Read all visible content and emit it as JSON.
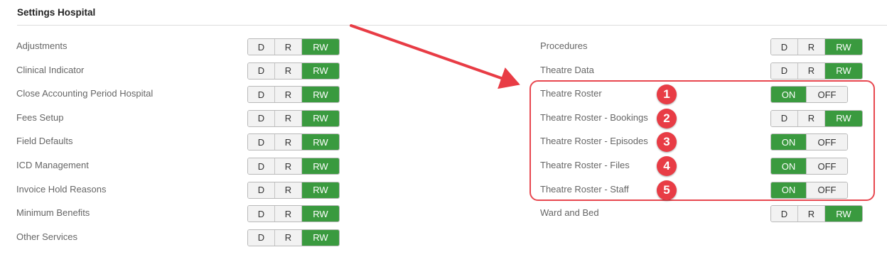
{
  "section": {
    "title": "Settings Hospital"
  },
  "perm_labels": {
    "d": "D",
    "r": "R",
    "rw": "RW",
    "on": "ON",
    "off": "OFF"
  },
  "left_rows": [
    {
      "label": "Adjustments",
      "type": "drw",
      "value": "RW"
    },
    {
      "label": "Clinical Indicator",
      "type": "drw",
      "value": "RW"
    },
    {
      "label": "Close Accounting Period Hospital",
      "type": "drw",
      "value": "RW"
    },
    {
      "label": "Fees Setup",
      "type": "drw",
      "value": "RW"
    },
    {
      "label": "Field Defaults",
      "type": "drw",
      "value": "RW"
    },
    {
      "label": "ICD Management",
      "type": "drw",
      "value": "RW"
    },
    {
      "label": "Invoice Hold Reasons",
      "type": "drw",
      "value": "RW"
    },
    {
      "label": "Minimum Benefits",
      "type": "drw",
      "value": "RW"
    },
    {
      "label": "Other Services",
      "type": "drw",
      "value": "RW"
    }
  ],
  "right_rows": [
    {
      "label": "Procedures",
      "type": "drw",
      "value": "RW"
    },
    {
      "label": "Theatre Data",
      "type": "drw",
      "value": "RW"
    },
    {
      "label": "Theatre Roster",
      "type": "onoff",
      "value": "ON",
      "badge": "1"
    },
    {
      "label": "Theatre Roster - Bookings",
      "type": "drw",
      "value": "RW",
      "badge": "2"
    },
    {
      "label": "Theatre Roster - Episodes",
      "type": "onoff",
      "value": "ON",
      "badge": "3"
    },
    {
      "label": "Theatre Roster - Files",
      "type": "onoff",
      "value": "ON",
      "badge": "4"
    },
    {
      "label": "Theatre Roster - Staff",
      "type": "onoff",
      "value": "ON",
      "badge": "5"
    },
    {
      "label": "Ward and Bed",
      "type": "drw",
      "value": "RW"
    }
  ],
  "colors": {
    "active_green": "#3a9a3f",
    "annotation_red": "#e83c45"
  }
}
